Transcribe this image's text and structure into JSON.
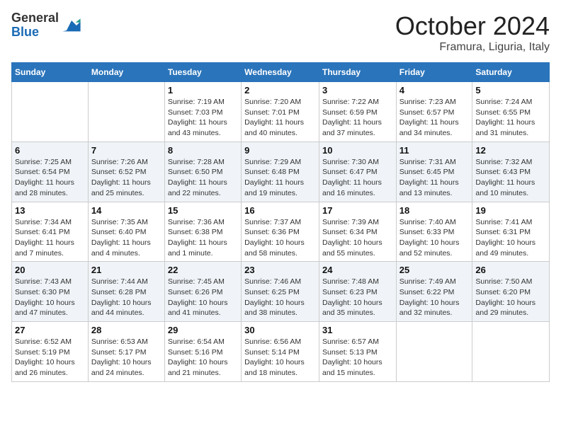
{
  "logo": {
    "general": "General",
    "blue": "Blue"
  },
  "title": "October 2024",
  "location": "Framura, Liguria, Italy",
  "headers": [
    "Sunday",
    "Monday",
    "Tuesday",
    "Wednesday",
    "Thursday",
    "Friday",
    "Saturday"
  ],
  "weeks": [
    [
      {
        "day": "",
        "info": ""
      },
      {
        "day": "",
        "info": ""
      },
      {
        "day": "1",
        "info": "Sunrise: 7:19 AM\nSunset: 7:03 PM\nDaylight: 11 hours and 43 minutes."
      },
      {
        "day": "2",
        "info": "Sunrise: 7:20 AM\nSunset: 7:01 PM\nDaylight: 11 hours and 40 minutes."
      },
      {
        "day": "3",
        "info": "Sunrise: 7:22 AM\nSunset: 6:59 PM\nDaylight: 11 hours and 37 minutes."
      },
      {
        "day": "4",
        "info": "Sunrise: 7:23 AM\nSunset: 6:57 PM\nDaylight: 11 hours and 34 minutes."
      },
      {
        "day": "5",
        "info": "Sunrise: 7:24 AM\nSunset: 6:55 PM\nDaylight: 11 hours and 31 minutes."
      }
    ],
    [
      {
        "day": "6",
        "info": "Sunrise: 7:25 AM\nSunset: 6:54 PM\nDaylight: 11 hours and 28 minutes."
      },
      {
        "day": "7",
        "info": "Sunrise: 7:26 AM\nSunset: 6:52 PM\nDaylight: 11 hours and 25 minutes."
      },
      {
        "day": "8",
        "info": "Sunrise: 7:28 AM\nSunset: 6:50 PM\nDaylight: 11 hours and 22 minutes."
      },
      {
        "day": "9",
        "info": "Sunrise: 7:29 AM\nSunset: 6:48 PM\nDaylight: 11 hours and 19 minutes."
      },
      {
        "day": "10",
        "info": "Sunrise: 7:30 AM\nSunset: 6:47 PM\nDaylight: 11 hours and 16 minutes."
      },
      {
        "day": "11",
        "info": "Sunrise: 7:31 AM\nSunset: 6:45 PM\nDaylight: 11 hours and 13 minutes."
      },
      {
        "day": "12",
        "info": "Sunrise: 7:32 AM\nSunset: 6:43 PM\nDaylight: 11 hours and 10 minutes."
      }
    ],
    [
      {
        "day": "13",
        "info": "Sunrise: 7:34 AM\nSunset: 6:41 PM\nDaylight: 11 hours and 7 minutes."
      },
      {
        "day": "14",
        "info": "Sunrise: 7:35 AM\nSunset: 6:40 PM\nDaylight: 11 hours and 4 minutes."
      },
      {
        "day": "15",
        "info": "Sunrise: 7:36 AM\nSunset: 6:38 PM\nDaylight: 11 hours and 1 minute."
      },
      {
        "day": "16",
        "info": "Sunrise: 7:37 AM\nSunset: 6:36 PM\nDaylight: 10 hours and 58 minutes."
      },
      {
        "day": "17",
        "info": "Sunrise: 7:39 AM\nSunset: 6:34 PM\nDaylight: 10 hours and 55 minutes."
      },
      {
        "day": "18",
        "info": "Sunrise: 7:40 AM\nSunset: 6:33 PM\nDaylight: 10 hours and 52 minutes."
      },
      {
        "day": "19",
        "info": "Sunrise: 7:41 AM\nSunset: 6:31 PM\nDaylight: 10 hours and 49 minutes."
      }
    ],
    [
      {
        "day": "20",
        "info": "Sunrise: 7:43 AM\nSunset: 6:30 PM\nDaylight: 10 hours and 47 minutes."
      },
      {
        "day": "21",
        "info": "Sunrise: 7:44 AM\nSunset: 6:28 PM\nDaylight: 10 hours and 44 minutes."
      },
      {
        "day": "22",
        "info": "Sunrise: 7:45 AM\nSunset: 6:26 PM\nDaylight: 10 hours and 41 minutes."
      },
      {
        "day": "23",
        "info": "Sunrise: 7:46 AM\nSunset: 6:25 PM\nDaylight: 10 hours and 38 minutes."
      },
      {
        "day": "24",
        "info": "Sunrise: 7:48 AM\nSunset: 6:23 PM\nDaylight: 10 hours and 35 minutes."
      },
      {
        "day": "25",
        "info": "Sunrise: 7:49 AM\nSunset: 6:22 PM\nDaylight: 10 hours and 32 minutes."
      },
      {
        "day": "26",
        "info": "Sunrise: 7:50 AM\nSunset: 6:20 PM\nDaylight: 10 hours and 29 minutes."
      }
    ],
    [
      {
        "day": "27",
        "info": "Sunrise: 6:52 AM\nSunset: 5:19 PM\nDaylight: 10 hours and 26 minutes."
      },
      {
        "day": "28",
        "info": "Sunrise: 6:53 AM\nSunset: 5:17 PM\nDaylight: 10 hours and 24 minutes."
      },
      {
        "day": "29",
        "info": "Sunrise: 6:54 AM\nSunset: 5:16 PM\nDaylight: 10 hours and 21 minutes."
      },
      {
        "day": "30",
        "info": "Sunrise: 6:56 AM\nSunset: 5:14 PM\nDaylight: 10 hours and 18 minutes."
      },
      {
        "day": "31",
        "info": "Sunrise: 6:57 AM\nSunset: 5:13 PM\nDaylight: 10 hours and 15 minutes."
      },
      {
        "day": "",
        "info": ""
      },
      {
        "day": "",
        "info": ""
      }
    ]
  ]
}
